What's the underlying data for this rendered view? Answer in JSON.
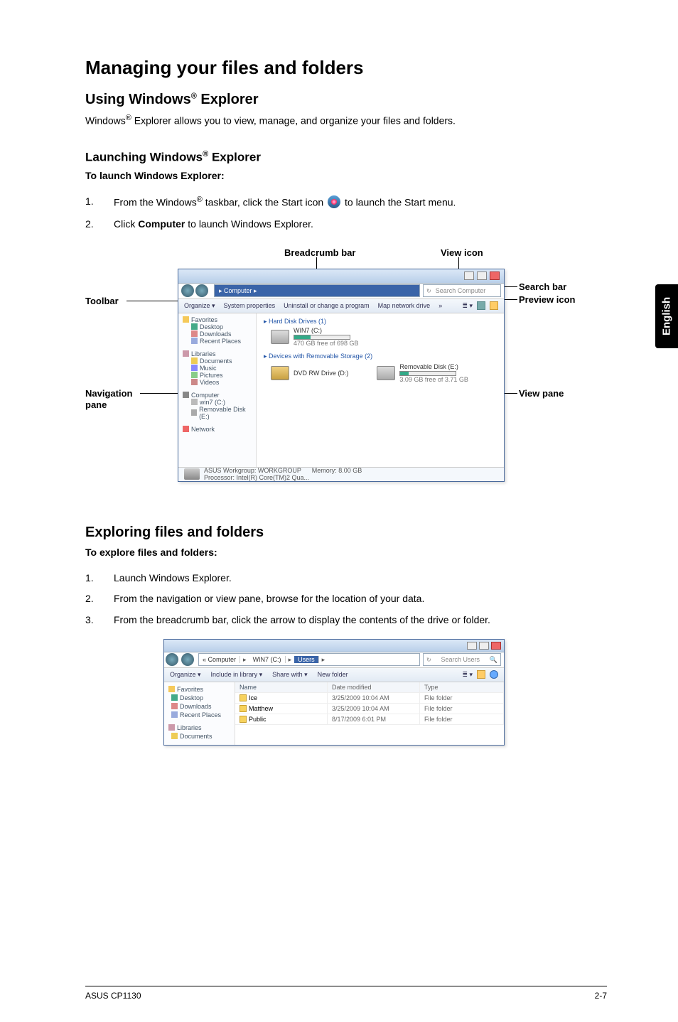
{
  "sidetab": "English",
  "h1": "Managing your files and folders",
  "h2_using_pre": "Using Windows",
  "h2_using_post": " Explorer",
  "p_intro_pre": "Windows",
  "p_intro_post": " Explorer allows you to view, manage, and organize your files and folders.",
  "h3_launch_pre": "Launching Windows",
  "h3_launch_post": " Explorer",
  "p_launch_lead": "To launch Windows Explorer:",
  "steps_a": {
    "n1": "1.",
    "t1a": "From the Windows",
    "t1b": " taskbar, click the Start icon ",
    "t1c": " to launch the Start menu.",
    "n2": "2.",
    "t2a": "Click ",
    "t2b": "Computer",
    "t2c": " to launch Windows Explorer."
  },
  "labels": {
    "breadcrumb": "Breadcrumb bar",
    "viewicon": "View icon",
    "toolbar": "Toolbar",
    "searchbar": "Search bar",
    "previewicon": "Preview icon",
    "navpane1": "Navigation",
    "navpane2": "pane",
    "viewpane": "View pane"
  },
  "explorer": {
    "crumb": "▸ Computer ▸",
    "search": "Search Computer",
    "tool": {
      "organize": "Organize ▾",
      "sysprops": "System properties",
      "uninstall": "Uninstall or change a program",
      "mapdrive": "Map network drive",
      "chev": "»"
    },
    "nav": {
      "fav": "Favorites",
      "desk": "Desktop",
      "dl": "Downloads",
      "rec": "Recent Places",
      "lib": "Libraries",
      "doc": "Documents",
      "mus": "Music",
      "pic": "Pictures",
      "vid": "Videos",
      "comp": "Computer",
      "hdd": "win7 (C:)",
      "rem": "Removable Disk (E:)",
      "net": "Network"
    },
    "view": {
      "sec1": "▸ Hard Disk Drives (1)",
      "drv1": "WIN7 (C:)",
      "drv1sub": "470 GB free of 698 GB",
      "sec2": "▸ Devices with Removable Storage (2)",
      "drv2": "DVD RW Drive (D:)",
      "drv3": "Removable Disk (E:)",
      "drv3sub": "3.09 GB free of 3.71 GB"
    },
    "status": {
      "l1": "ASUS Workgroup: WORKGROUP",
      "l2": "Processor: Intel(R) Core(TM)2 Qua...",
      "l3": "Memory: 8.00 GB"
    }
  },
  "h2_explore": "Exploring files and folders",
  "p_explore_lead": "To explore files and folders:",
  "steps_b": {
    "n1": "1.",
    "t1": "Launch Windows Explorer.",
    "n2": "2.",
    "t2": "From the navigation or view pane, browse for the location of your data.",
    "n3": "3.",
    "t3": "From the breadcrumb bar, click the arrow to display the contents of the drive or folder."
  },
  "explorer2": {
    "crumb": {
      "seg1": "« Computer",
      "seg2": "WIN7 (C:)",
      "seg3": "Users",
      "arr": "▸"
    },
    "search": "Search Users",
    "tool": {
      "organize": "Organize ▾",
      "include": "Include in library ▾",
      "share": "Share with ▾",
      "newfolder": "New folder"
    },
    "nav": {
      "fav": "Favorites",
      "desk": "Desktop",
      "dl": "Downloads",
      "rec": "Recent Places",
      "lib": "Libraries",
      "doc": "Documents"
    },
    "hdr": {
      "name": "Name",
      "date": "Date modified",
      "type": "Type"
    },
    "rows": [
      {
        "name": "Ice",
        "date": "3/25/2009 10:04 AM",
        "type": "File folder"
      },
      {
        "name": "Matthew",
        "date": "3/25/2009 10:04 AM",
        "type": "File folder"
      },
      {
        "name": "Public",
        "date": "8/17/2009 6:01 PM",
        "type": "File folder"
      }
    ]
  },
  "footer": {
    "left": "ASUS CP1130",
    "right": "2-7"
  }
}
